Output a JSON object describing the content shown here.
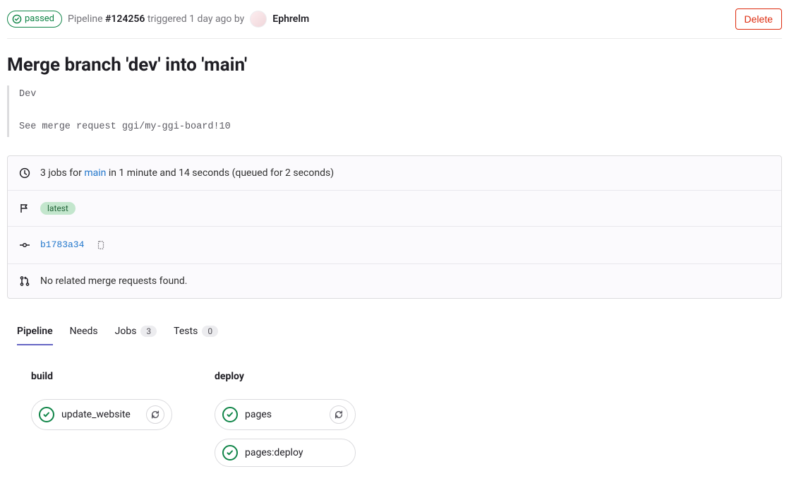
{
  "header": {
    "status_label": "passed",
    "pipeline_prefix": "Pipeline ",
    "pipeline_id": "#124256",
    "triggered_text": " triggered 1 day ago by",
    "author": "Ephrelm",
    "delete_label": "Delete"
  },
  "title": "Merge branch 'dev' into 'main'",
  "commit_message": "Dev\n\nSee merge request ggi/my-ggi-board!10",
  "info": {
    "jobs_prefix": "3 jobs for ",
    "branch": "main",
    "jobs_suffix": " in 1 minute and 14 seconds (queued for 2 seconds)",
    "tag_label": "latest",
    "commit_sha": "b1783a34",
    "mr_text": "No related merge requests found."
  },
  "tabs": {
    "pipeline": "Pipeline",
    "needs": "Needs",
    "jobs": "Jobs",
    "jobs_count": "3",
    "tests": "Tests",
    "tests_count": "0"
  },
  "stages": [
    {
      "name": "build",
      "jobs": [
        {
          "name": "update_website",
          "retry": true
        }
      ]
    },
    {
      "name": "deploy",
      "jobs": [
        {
          "name": "pages",
          "retry": true
        },
        {
          "name": "pages:deploy",
          "retry": false
        }
      ]
    }
  ]
}
